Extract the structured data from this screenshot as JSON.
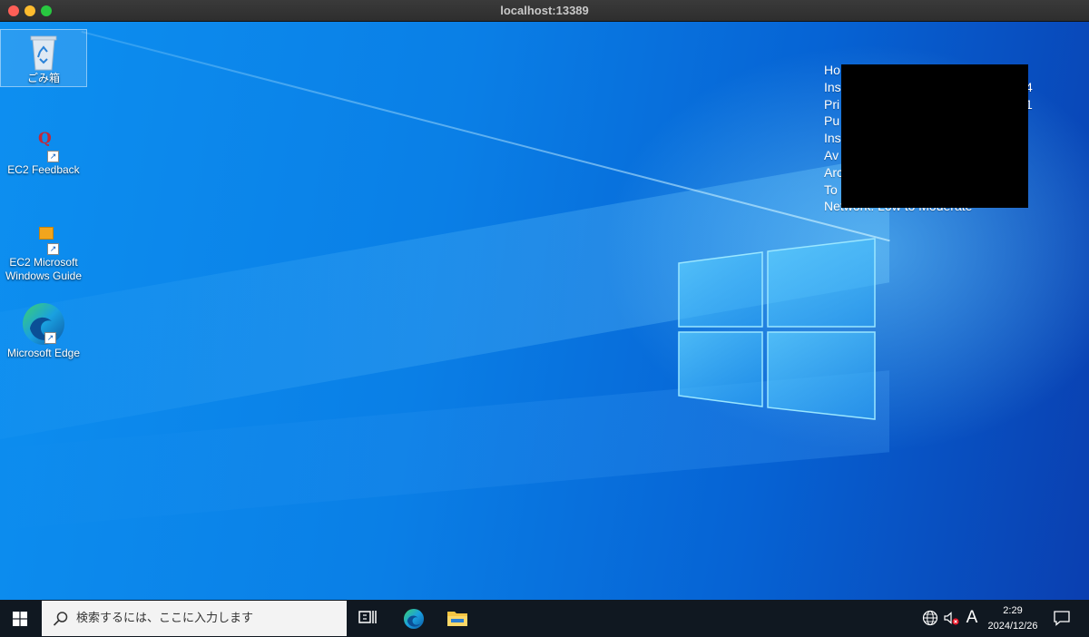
{
  "window": {
    "title": "localhost:13389"
  },
  "desktop": {
    "icons": [
      {
        "label": "ごみ箱",
        "icon": "recycle-bin-icon"
      },
      {
        "label": "EC2 Feedback",
        "icon": "ec2-feedback-icon"
      },
      {
        "label": "EC2 Microsoft Windows Guide",
        "line1": "EC2 Microsoft",
        "line2": "Windows Guide",
        "icon": "ec2-guide-icon"
      },
      {
        "label": "Microsoft Edge",
        "icon": "edge-icon"
      }
    ],
    "sysinfo": {
      "lines": [
        "Ho",
        "Ins",
        "Pri",
        "Pu",
        "Ins",
        "Av",
        "Arc",
        "To",
        "Network: Low to Moderate"
      ],
      "visible_tail": [
        "",
        "4",
        "1",
        "",
        "",
        "",
        "",
        "",
        ""
      ]
    }
  },
  "taskbar": {
    "search_placeholder": "検索するには、ここに入力します",
    "ime_indicator": "A",
    "clock_time": "2:29",
    "clock_date": "2024/12/26"
  },
  "colors": {
    "desktop_blue": "#0a7fe6",
    "taskbar": "#101821",
    "title_bar": "#2e2e2e"
  }
}
